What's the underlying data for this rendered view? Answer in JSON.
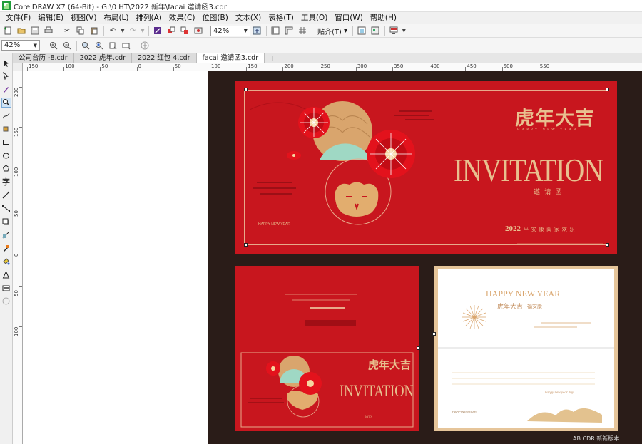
{
  "window": {
    "title": "CorelDRAW X7 (64-Bit) - G:\\0 HT\\2022 新年\\facai 邀请函3.cdr"
  },
  "menu": [
    "文件(F)",
    "编辑(E)",
    "视图(V)",
    "布局(L)",
    "排列(A)",
    "效果(C)",
    "位图(B)",
    "文本(X)",
    "表格(T)",
    "工具(O)",
    "窗口(W)",
    "帮助(H)"
  ],
  "toolbar": {
    "zoom": "42%",
    "snap_label": "贴齐(T)"
  },
  "propbar": {
    "zoom": "42%"
  },
  "tabs": [
    "公司台历 -8.cdr",
    "2022 虎年.cdr",
    "2022 红包 4.cdr",
    "facai 邀请函3.cdr"
  ],
  "active_tab": 3,
  "ruler_h": [
    "150",
    "100",
    "50",
    "0",
    "50",
    "100",
    "150",
    "200",
    "250",
    "300",
    "350",
    "400",
    "450",
    "500",
    "550"
  ],
  "ruler_v": [
    "200",
    "150",
    "100",
    "50",
    "0",
    "50",
    "100"
  ],
  "design": {
    "title_cn": "虎年大吉",
    "subtitle_en": "HAPPY NEW YEAR",
    "invitation": "INVITATION",
    "invitation_cn": "邀 请 函",
    "year": "2022",
    "blessing": "平 安 康  阖 家 欢 乐",
    "tiny_hny": "HAPPY NEW YEAR",
    "card_br_hny": "HAPPY NEW YEAR",
    "card_br_cn": "虎年大吉",
    "card_br_cn2": "福安康",
    "card_br_script": "happy new year day",
    "card_br_footer": "HAPPYNEWYEAR"
  },
  "watermark": "AB CDR 新新版本",
  "colors": {
    "red": "#c8161e",
    "gold": "#e8c08f",
    "mint": "#9fd8c4",
    "dark": "#2a1c18"
  }
}
